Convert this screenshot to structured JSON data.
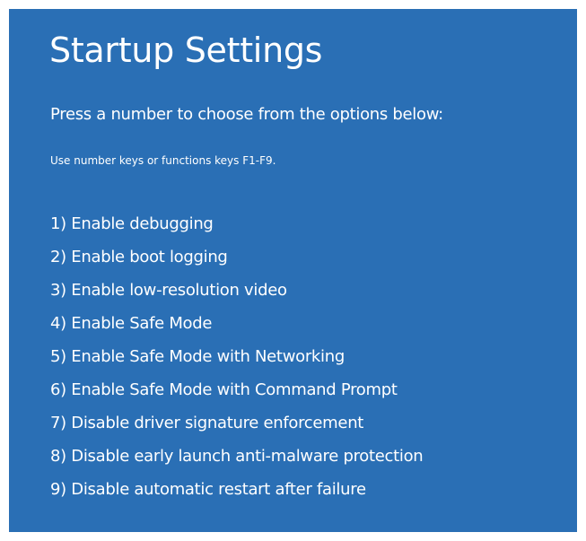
{
  "title": "Startup Settings",
  "prompt": "Press a number to choose from the options below:",
  "hint": "Use number keys or functions keys F1-F9.",
  "options": [
    {
      "label": "1) Enable debugging"
    },
    {
      "label": "2) Enable boot logging"
    },
    {
      "label": "3) Enable low-resolution video"
    },
    {
      "label": "4) Enable Safe Mode"
    },
    {
      "label": "5) Enable Safe Mode with Networking"
    },
    {
      "label": "6) Enable Safe Mode with Command Prompt"
    },
    {
      "label": "7) Disable driver signature enforcement"
    },
    {
      "label": "8) Disable early launch anti-malware protection"
    },
    {
      "label": "9) Disable automatic restart after failure"
    }
  ],
  "colors": {
    "background": "#2a6fb5",
    "text": "#ffffff"
  }
}
